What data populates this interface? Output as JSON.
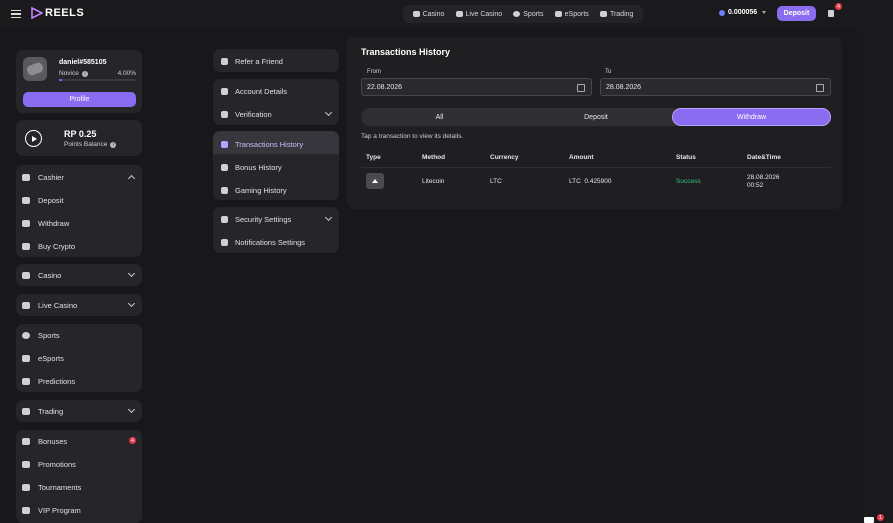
{
  "header": {
    "logo_text": "REELS",
    "nav": [
      {
        "label": "Casino",
        "icon": "casino-icon"
      },
      {
        "label": "Live Casino",
        "icon": "live-casino-icon"
      },
      {
        "label": "Sports",
        "icon": "sports-ball-icon"
      },
      {
        "label": "eSports",
        "icon": "gamepad-icon"
      },
      {
        "label": "Trading",
        "icon": "trading-chart-icon"
      }
    ],
    "balance": "0.000056",
    "deposit_label": "Deposit",
    "gift_badge": "4"
  },
  "profile": {
    "username": "daniel#585105",
    "level": "Novice",
    "progress_pct": "4.00%",
    "progress_value": 0.04,
    "button": "Profile"
  },
  "points": {
    "value": "RP  0.25",
    "label": "Points Balance"
  },
  "sidebar": {
    "cashier": {
      "label": "Cashier",
      "items": [
        "Deposit",
        "Withdraw",
        "Buy Crypto"
      ]
    },
    "casino": "Casino",
    "live_casino": "Live Casino",
    "sports_group": [
      "Sports",
      "eSports",
      "Predictions"
    ],
    "trading": "Trading",
    "bonus_group": [
      "Bonuses",
      "Promotions",
      "Tournaments",
      "VIP Program"
    ],
    "bonuses_badge": "4"
  },
  "settings_menu": {
    "group1": [
      "Refer a Friend"
    ],
    "group2": [
      "Account Details",
      "Verification"
    ],
    "group3": [
      "Transactions History",
      "Bonus History",
      "Gaming History"
    ],
    "group4": [
      "Security Settings",
      "Notifications Settings"
    ]
  },
  "transactions": {
    "title": "Transactions History",
    "from_label": "From",
    "to_label": "To",
    "from_date": "22.08.2026",
    "to_date": "28.08.2026",
    "tabs": [
      "All",
      "Deposit",
      "Withdraw"
    ],
    "active_tab": "Withdraw",
    "hint": "Tap a transaction to view its details.",
    "columns": [
      "Type",
      "Method",
      "Currency",
      "Amount",
      "Status",
      "Date&Time"
    ],
    "rows": [
      {
        "method": "Litecoin",
        "currency": "LTC",
        "amount": "LTC  0.425900",
        "status": "Success",
        "date": "28.08.2026",
        "time": "00:52"
      }
    ]
  },
  "chat_badge": "1",
  "colors": {
    "accent": "#8a6cf0",
    "success": "#34c77b",
    "badge": "#e23b4a"
  }
}
